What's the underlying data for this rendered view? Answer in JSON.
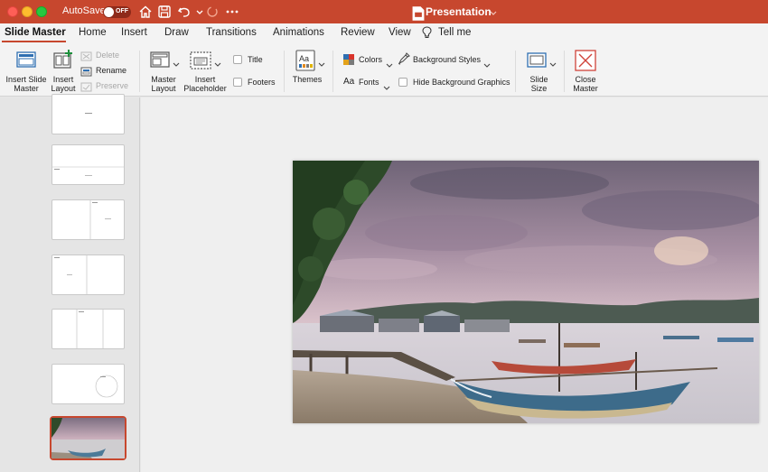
{
  "titlebar": {
    "autosave_label": "AutoSave",
    "autosave_state": "OFF",
    "document_title": "Presentation",
    "icons": [
      "home-icon",
      "save-icon",
      "undo-icon",
      "redo-icon",
      "more-icon"
    ]
  },
  "tabs": [
    {
      "label": "Slide Master",
      "active": true
    },
    {
      "label": "Home"
    },
    {
      "label": "Insert"
    },
    {
      "label": "Draw"
    },
    {
      "label": "Transitions"
    },
    {
      "label": "Animations"
    },
    {
      "label": "Review"
    },
    {
      "label": "View"
    },
    {
      "label": "Tell me"
    }
  ],
  "ribbon": {
    "insert_slide_master": "Insert Slide Master",
    "insert_layout": "Insert Layout",
    "delete": "Delete",
    "rename": "Rename",
    "preserve": "Preserve",
    "master_layout": "Master Layout",
    "insert_placeholder": "Insert Placeholder",
    "title": "Title",
    "footers": "Footers",
    "themes": "Themes",
    "colors": "Colors",
    "fonts": "Fonts",
    "background_styles": "Background Styles",
    "hide_background_graphics": "Hide Background Graphics",
    "slide_size": "Slide Size",
    "close_master": "Close Master"
  },
  "colors": {
    "accent": "#c7472e",
    "ribbon_bg": "#f3f3f3",
    "panel_bg": "#e5e5e5"
  }
}
